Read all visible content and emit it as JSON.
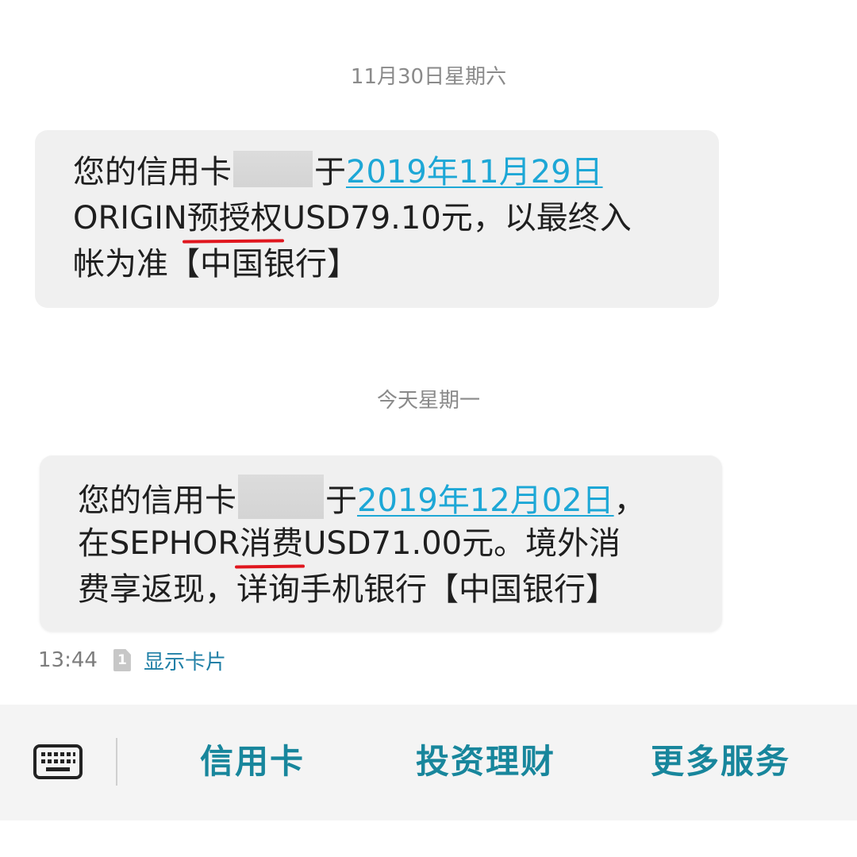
{
  "messages": [
    {
      "date_header": "11月30日星期六",
      "line1_pre": "您的信用卡",
      "line1_post": "于",
      "date_link": "2019年11月29日",
      "line1_tail": "",
      "line2_pre": "ORIGIN",
      "line2_mark": "预授权",
      "line2_post": "USD79.10元，以最终入",
      "line3": "帐为准【中国银行】"
    },
    {
      "date_header": "今天星期一",
      "line1_pre": "您的信用卡",
      "line1_post": "于",
      "date_link": "2019年12月02日",
      "line1_tail": "，",
      "line2_pre": "在SEPHOR",
      "line2_mark": "消费",
      "line2_post": "USD71.00元。境外消",
      "line3": "费享返现，详询手机银行【中国银行】",
      "time": "13:44",
      "sim_slot": "1",
      "show_card_label": "显示卡片"
    }
  ],
  "bottom_bar": {
    "keyboard_icon": "keyboard-icon",
    "items": [
      "信用卡",
      "投资理财",
      "更多服务"
    ]
  },
  "colors": {
    "link": "#1da7d6",
    "highlight_underline": "#e0161e",
    "menu_text": "#18869c",
    "bubble_bg": "#f0f0f0"
  }
}
